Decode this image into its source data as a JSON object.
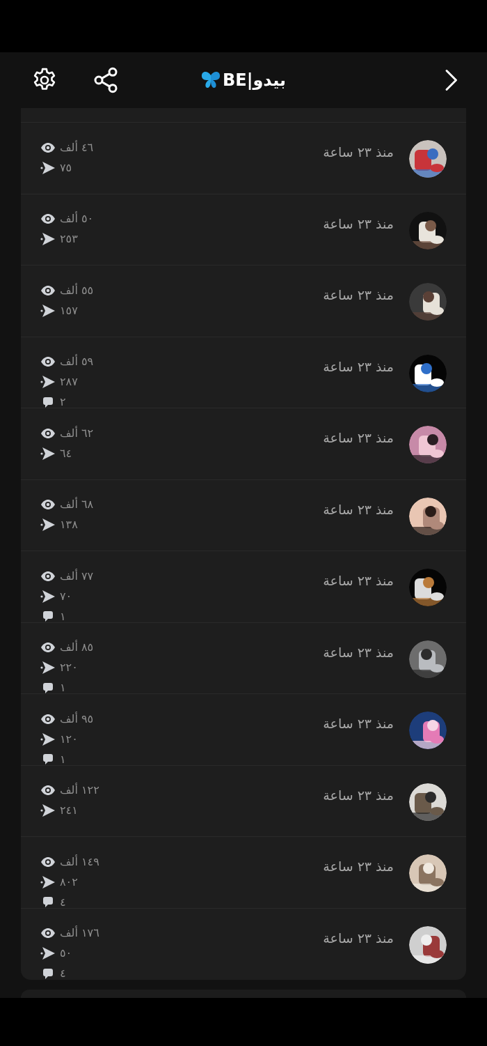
{
  "header": {
    "title": "BE|بيدو"
  },
  "rows": [
    {
      "time": "منذ ٢٣ ساعة",
      "views": "٤٦ ألف",
      "shares": "٧٥"
    },
    {
      "time": "منذ ٢٣ ساعة",
      "views": "٥٠ ألف",
      "shares": "٢٥٣"
    },
    {
      "time": "منذ ٢٣ ساعة",
      "views": "٥٥ ألف",
      "shares": "١٥٧"
    },
    {
      "time": "منذ ٢٣ ساعة",
      "views": "٥٩ ألف",
      "shares": "٢٨٧",
      "comments": "٢"
    },
    {
      "time": "منذ ٢٣ ساعة",
      "views": "٦٢ ألف",
      "shares": "٦٤"
    },
    {
      "time": "منذ ٢٣ ساعة",
      "views": "٦٨ ألف",
      "shares": "١٣٨"
    },
    {
      "time": "منذ ٢٣ ساعة",
      "views": "٧٧ ألف",
      "shares": "٧٠",
      "comments": "١"
    },
    {
      "time": "منذ ٢٣ ساعة",
      "views": "٨٥ ألف",
      "shares": "٢٢٠",
      "comments": "١"
    },
    {
      "time": "منذ ٢٣ ساعة",
      "views": "٩٥ ألف",
      "shares": "١٢٠",
      "comments": "١"
    },
    {
      "time": "منذ ٢٣ ساعة",
      "views": "١٢٢ ألف",
      "shares": "٢٤١"
    },
    {
      "time": "منذ ٢٣ ساعة",
      "views": "١٤٩ ألف",
      "shares": "٨٠٢",
      "comments": "٤"
    },
    {
      "time": "منذ ٢٣ ساعة",
      "views": "١٧٦ ألف",
      "shares": "٥٠",
      "comments": "٤"
    }
  ]
}
